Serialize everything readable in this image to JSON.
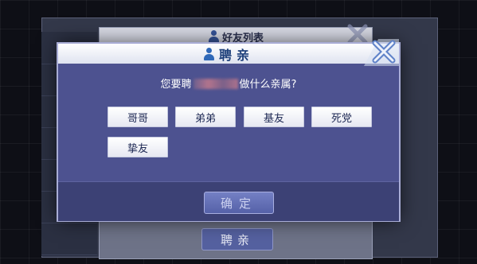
{
  "background_panel": {
    "title": "好友列表",
    "button_label": "聘亲"
  },
  "dialog": {
    "title": "聘亲",
    "question_prefix": "您要聘",
    "question_suffix": "做什么亲属?",
    "options": [
      "哥哥",
      "弟弟",
      "基友",
      "死党",
      "挚友"
    ],
    "confirm_label": "确定"
  },
  "colors": {
    "dialog_body": "#4d5290",
    "dialog_header": "#ffffff",
    "option_bg": "#ffffff",
    "confirm_button": "#5561a8",
    "close_x": "#6e8fd0"
  },
  "icons": [
    "user-icon",
    "close-icon"
  ]
}
